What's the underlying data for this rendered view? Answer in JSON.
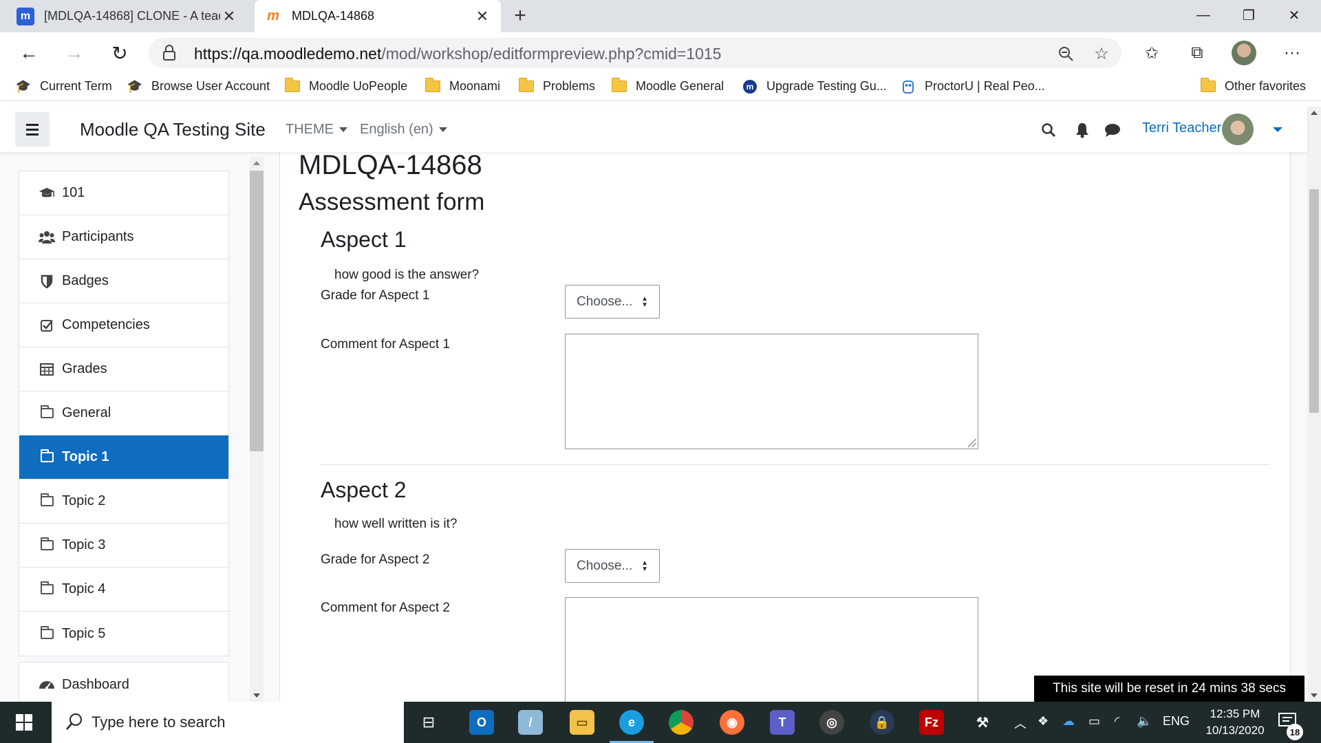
{
  "browser": {
    "tabs": [
      {
        "title": "[MDLQA-14868] CLONE - A teac",
        "favicon": "m-icon"
      },
      {
        "title": "MDLQA-14868",
        "favicon": "moodle-icon"
      }
    ],
    "url_host": "https://qa.moodledemo.net",
    "url_path": "/mod/workshop/editformpreview.php?cmid=1015",
    "favorites": [
      {
        "label": "Current Term",
        "icon": "cap-icon"
      },
      {
        "label": "Browse User Account",
        "icon": "cap-icon"
      },
      {
        "label": "Moodle UoPeople",
        "icon": "folder-icon"
      },
      {
        "label": "Moonami",
        "icon": "folder-icon"
      },
      {
        "label": "Problems",
        "icon": "folder-icon"
      },
      {
        "label": "Moodle General",
        "icon": "folder-icon"
      },
      {
        "label": "Upgrade Testing Gu...",
        "icon": "m-circle-icon"
      },
      {
        "label": "ProctorU | Real Peo...",
        "icon": "owl-icon"
      },
      {
        "label": "Other favorites",
        "icon": "folder-icon"
      }
    ]
  },
  "moodle": {
    "site_name": "Moodle QA Testing Site",
    "theme_menu": "THEME",
    "language_menu": "English (en)",
    "user_name": "Terri Teacher"
  },
  "drawer": {
    "items": [
      {
        "label": "101",
        "icon": "graduation-cap-icon"
      },
      {
        "label": "Participants",
        "icon": "users-icon"
      },
      {
        "label": "Badges",
        "icon": "shield-icon"
      },
      {
        "label": "Competencies",
        "icon": "check-square-icon"
      },
      {
        "label": "Grades",
        "icon": "table-icon"
      },
      {
        "label": "General",
        "icon": "folder-icon"
      },
      {
        "label": "Topic 1",
        "icon": "folder-icon",
        "active": true
      },
      {
        "label": "Topic 2",
        "icon": "folder-icon"
      },
      {
        "label": "Topic 3",
        "icon": "folder-icon"
      },
      {
        "label": "Topic 4",
        "icon": "folder-icon"
      },
      {
        "label": "Topic 5",
        "icon": "folder-icon"
      }
    ],
    "dashboard": "Dashboard"
  },
  "main": {
    "heading": "MDLQA-14868",
    "subheading": "Assessment form",
    "aspects": [
      {
        "title": "Aspect 1",
        "description": "how good is the answer?",
        "grade_label": "Grade for Aspect 1",
        "grade_value": "Choose...",
        "comment_label": "Comment for Aspect 1"
      },
      {
        "title": "Aspect 2",
        "description": "how well written is it?",
        "grade_label": "Grade for Aspect 2",
        "grade_value": "Choose...",
        "comment_label": "Comment for Aspect 2"
      }
    ]
  },
  "reset_banner": "This site will be reset in 24 mins 38 secs",
  "taskbar": {
    "search_placeholder": "Type here to search",
    "language": "ENG",
    "time": "12:35 PM",
    "date": "10/13/2020",
    "notification_count": "18"
  },
  "colors": {
    "accent": "#0f6cbf",
    "taskbar": "#1f2b2b",
    "active_drawer": "#0f6cbf"
  }
}
